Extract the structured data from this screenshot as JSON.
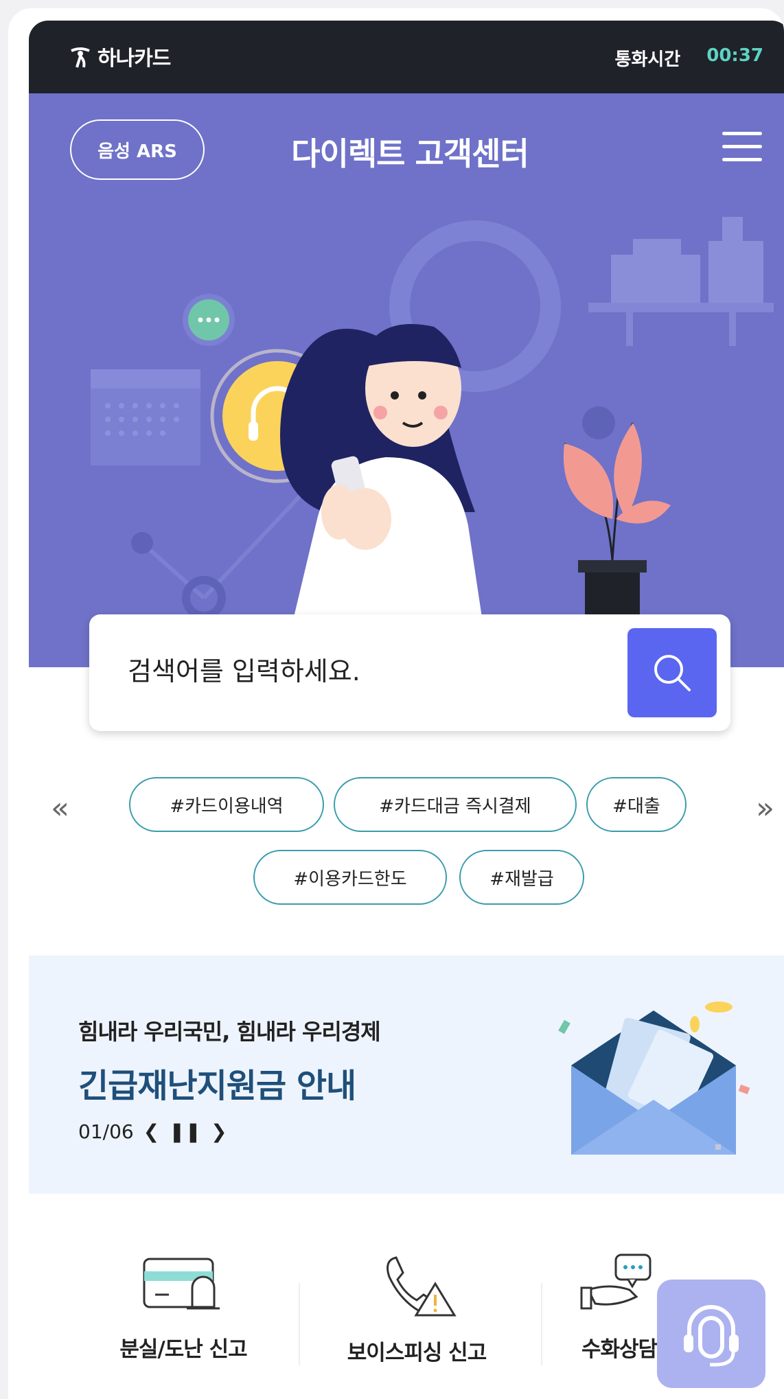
{
  "status_bar": {
    "brand": "하나카드",
    "call_label": "통화시간",
    "call_time": "00:37"
  },
  "header": {
    "ars_label": "음성 ARS",
    "title": "다이렉트 고객센터",
    "menu_icon": "hamburger-menu-icon"
  },
  "search": {
    "placeholder": "검색어를 입력하세요.",
    "icon": "search-icon"
  },
  "tags": {
    "prev": "«",
    "next": "»",
    "items": [
      "#카드이용내역",
      "#카드대금 즉시결제",
      "#대출",
      "#이용카드한도",
      "#재발급"
    ]
  },
  "banner": {
    "subtitle": "힘내라 우리국민, 힘내라 우리경제",
    "title": "긴급재난지원금 안내",
    "page": "01/06",
    "prev": "❮",
    "pause": "❚❚",
    "next": "❯"
  },
  "quick_menu": [
    {
      "label": "분실/도난 신고",
      "icon": "card-alarm-icon"
    },
    {
      "label": "보이스피싱 신고",
      "icon": "phone-warning-icon"
    },
    {
      "label": "수화상담",
      "icon": "sign-language-chat-icon"
    }
  ],
  "colors": {
    "status_bg": "#1f2229",
    "hero_bg": "#6f72c8",
    "search_btn": "#5a66f0",
    "tag_border": "#3a9cad",
    "banner_bg": "#eef4fd",
    "banner_title": "#1f4f7a",
    "call_time": "#5ed3c4"
  }
}
